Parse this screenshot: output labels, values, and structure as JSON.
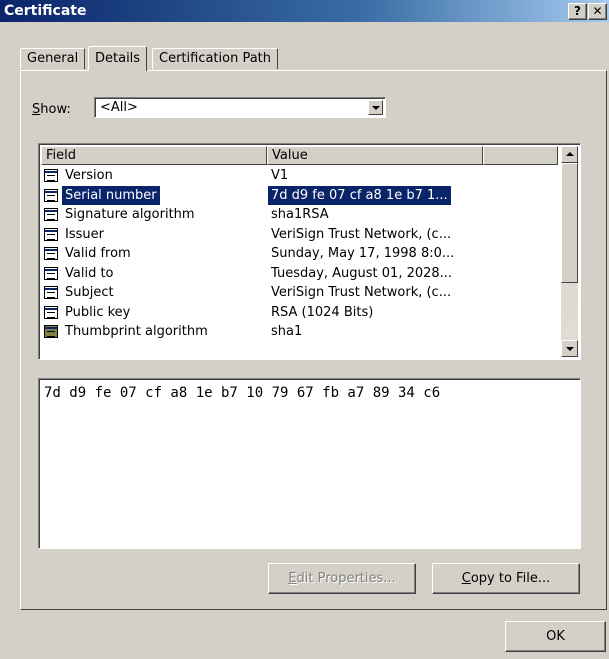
{
  "window": {
    "title": "Certificate",
    "help_glyph": "?",
    "close_glyph": "✕"
  },
  "tabs": [
    {
      "label": "General",
      "selected": false
    },
    {
      "label": "Details",
      "selected": true
    },
    {
      "label": "Certification Path",
      "selected": false
    }
  ],
  "show": {
    "label_prefix": "S",
    "label_rest": "how:",
    "selected_value": "<All>"
  },
  "list": {
    "columns": [
      "Field",
      "Value",
      ""
    ],
    "rows": [
      {
        "field": "Version",
        "value": "V1",
        "icon": "field-icon",
        "selected": false
      },
      {
        "field": "Serial number",
        "value": "7d d9 fe 07 cf a8 1e b7 1...",
        "icon": "field-icon",
        "selected": true
      },
      {
        "field": "Signature algorithm",
        "value": "sha1RSA",
        "icon": "field-icon",
        "selected": false
      },
      {
        "field": "Issuer",
        "value": "VeriSign Trust Network, (c...",
        "icon": "field-icon",
        "selected": false
      },
      {
        "field": "Valid from",
        "value": "Sunday, May 17, 1998 8:0...",
        "icon": "field-icon",
        "selected": false
      },
      {
        "field": "Valid to",
        "value": "Tuesday, August 01, 2028...",
        "icon": "field-icon",
        "selected": false
      },
      {
        "field": "Subject",
        "value": "VeriSign Trust Network, (c...",
        "icon": "field-icon",
        "selected": false
      },
      {
        "field": "Public key",
        "value": "RSA (1024 Bits)",
        "icon": "field-icon",
        "selected": false
      },
      {
        "field": "Thumbprint algorithm",
        "value": "sha1",
        "icon": "thumbprint-field-icon",
        "selected": false
      }
    ]
  },
  "detail": {
    "text": "7d d9 fe 07 cf a8 1e b7 10 79 67 fb a7 89 34 c6"
  },
  "buttons": {
    "edit_prefix": "E",
    "edit_rest": "dit Properties...",
    "copy_prefix": "C",
    "copy_rest": "opy to File...",
    "ok": "OK"
  },
  "colors": {
    "title_bar": "#0a246a",
    "selection": "#0a246a",
    "face": "#d4d0c8"
  }
}
